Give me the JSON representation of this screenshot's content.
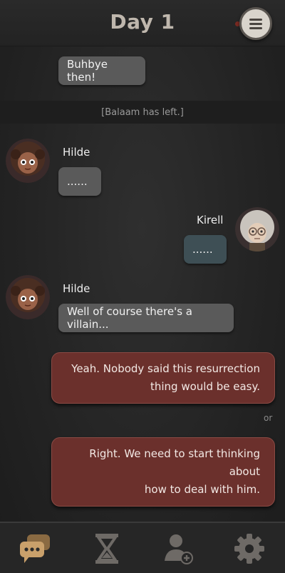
{
  "header": {
    "title": "Day 1",
    "menu_icon": "hamburger-menu-icon"
  },
  "messages": [
    {
      "text": "Buhbye then!"
    },
    {
      "system": "[Balaam has left.]"
    },
    {
      "speaker": "Hilde",
      "text": "......"
    },
    {
      "speaker": "Kirell",
      "text": "......"
    },
    {
      "speaker": "Hilde",
      "text": "Well of course there's a villain..."
    }
  ],
  "choices": [
    {
      "line1": "Yeah. Nobody said this resurrection",
      "line2": "thing would be easy."
    },
    {
      "line1": "Right. We need to start thinking about",
      "line2": "how to deal with him."
    }
  ],
  "or_label": "or",
  "tabs": [
    {
      "icon": "chat-bubble-icon",
      "active": true
    },
    {
      "icon": "hourglass-icon",
      "active": false
    },
    {
      "icon": "add-contact-icon",
      "active": false
    },
    {
      "icon": "gear-icon",
      "active": false
    }
  ],
  "colors": {
    "accent": "#c9a06b",
    "choice": "#6b302c",
    "bubble": "#5a5a5a",
    "my_bubble": "#3e4f55"
  }
}
